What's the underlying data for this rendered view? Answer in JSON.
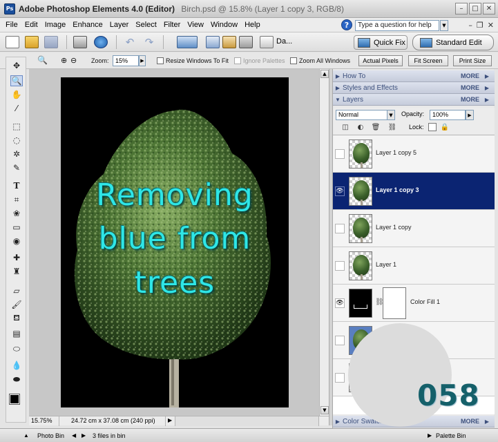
{
  "window": {
    "app_title": "Adobe Photoshop Elements 4.0 (Editor)",
    "document_title": "Birch.psd @ 15.8% (Layer 1 copy 3, RGB/8)"
  },
  "menu": {
    "items": [
      "File",
      "Edit",
      "Image",
      "Enhance",
      "Layer",
      "Select",
      "Filter",
      "View",
      "Window",
      "Help"
    ],
    "help_placeholder": "Type a question for help"
  },
  "shortcuts": {
    "date_view_label": "Da...",
    "quick_fix_label": "Quick Fix",
    "standard_edit_label": "Standard Edit"
  },
  "options_bar": {
    "zoom_label": "Zoom:",
    "zoom_value": "15%",
    "resize_windows_label": "Resize Windows To Fit",
    "ignore_palettes_label": "Ignore Palettes",
    "zoom_all_windows_label": "Zoom All Windows",
    "actual_pixels_label": "Actual Pixels",
    "fit_screen_label": "Fit Screen",
    "print_size_label": "Print Size"
  },
  "canvas": {
    "overlay_lines": [
      "Removing",
      "blue from",
      "trees"
    ],
    "text_color": "#2fe6e6"
  },
  "status_bar": {
    "zoom_percent": "15.75%",
    "doc_info": "24.72 cm x 37.08 cm (240 ppi)"
  },
  "palettes": {
    "how_to": "How To",
    "styles_effects": "Styles and Effects",
    "layers": "Layers",
    "more_label": "MORE",
    "color_swatches": "Color Swatches"
  },
  "layers_panel": {
    "blend_mode": "Normal",
    "opacity_label": "Opacity:",
    "opacity_value": "100%",
    "lock_label": "Lock:",
    "layers": [
      {
        "name": "Layer 1 copy 5",
        "visible": false,
        "selected": false
      },
      {
        "name": "Layer 1 copy 3",
        "visible": true,
        "selected": true
      },
      {
        "name": "Layer 1 copy",
        "visible": false,
        "selected": false
      },
      {
        "name": "Layer 1",
        "visible": false,
        "selected": false
      },
      {
        "name": "Color Fill 1",
        "visible": true,
        "selected": false
      }
    ]
  },
  "watermark_number": "058",
  "bottom_bar": {
    "photo_bin_label": "Photo Bin",
    "files_in_bin": "3 files in bin",
    "palette_bin_label": "Palette Bin"
  },
  "colors": {
    "selected_layer_bg": "#0b2472",
    "palette_header_text": "#3c4f7c",
    "tree_green": "#3a5f2a"
  }
}
